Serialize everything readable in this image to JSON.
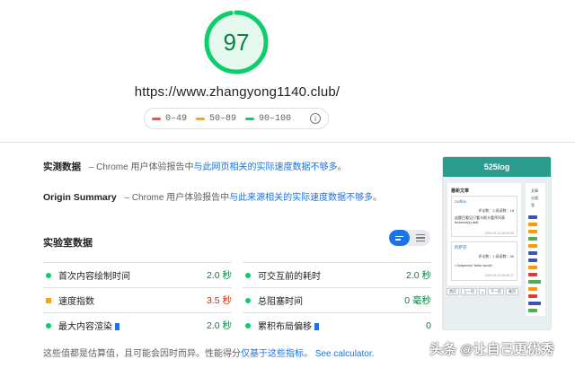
{
  "score": {
    "value": "97",
    "fraction": 0.97,
    "color": "#0cce6b"
  },
  "url": "https://www.zhangyong1140.club/",
  "legend": [
    {
      "label": "0–49",
      "color": "#ff4e42"
    },
    {
      "label": "50–89",
      "color": "#ffa400"
    },
    {
      "label": "90–100",
      "color": "#0cce6b"
    }
  ],
  "field_data": {
    "title": "实测数据",
    "text_prefix": "– Chrome 用户体验报告中",
    "link": "与此网页相关的实际速度数据不够多",
    "text_suffix": "。"
  },
  "origin_summary": {
    "title": "Origin Summary",
    "text_prefix": "– Chrome 用户体验报告中",
    "link": "与此来源相关的实际速度数据不够多",
    "text_suffix": "。"
  },
  "lab_data": {
    "title": "实验室数据",
    "metrics": [
      {
        "label": "首次内容绘制时间",
        "value": "2.0 秒",
        "rating": "good"
      },
      {
        "label": "可交互前的耗时",
        "value": "2.0 秒",
        "rating": "good"
      },
      {
        "label": "速度指数",
        "value": "3.5 秒",
        "rating": "average"
      },
      {
        "label": "总阻塞时间",
        "value": "0 毫秒",
        "rating": "good"
      },
      {
        "label": "最大内容渲染",
        "value": "2.0 秒",
        "rating": "good"
      },
      {
        "label": "累积布局偏移",
        "value": "0",
        "rating": "good"
      }
    ]
  },
  "footnote": {
    "text": "这些值都是估算值，且可能会因时而异。性能得分",
    "link1": "仅基于这些指标",
    "sep": "。",
    "link2": "See calculator."
  },
  "thumbnail": {
    "site_title": "525log",
    "section_title": "最新文章",
    "side_title_1": "文章",
    "side_title_2": "分类",
    "side_title_3": "签",
    "post1_title": "zxdfas",
    "post1_meta": "评论数：2  阅读数：15",
    "post1_text": "这题目看见只看卡斯卡看序列表 function(s) dsf)",
    "post1_date": "2020-09-24 08:05:53",
    "post2_title": "的萨芬",
    "post2_meta": "评论数：1  阅读数：30",
    "post2_text": "<?phpecho 'hello world';",
    "post2_date": "2020-09-24 08:05:17",
    "pager": [
      "首页",
      "上一页",
      "1",
      "下一页",
      "尾页"
    ]
  },
  "watermark": "头条 @让自己更优秀"
}
